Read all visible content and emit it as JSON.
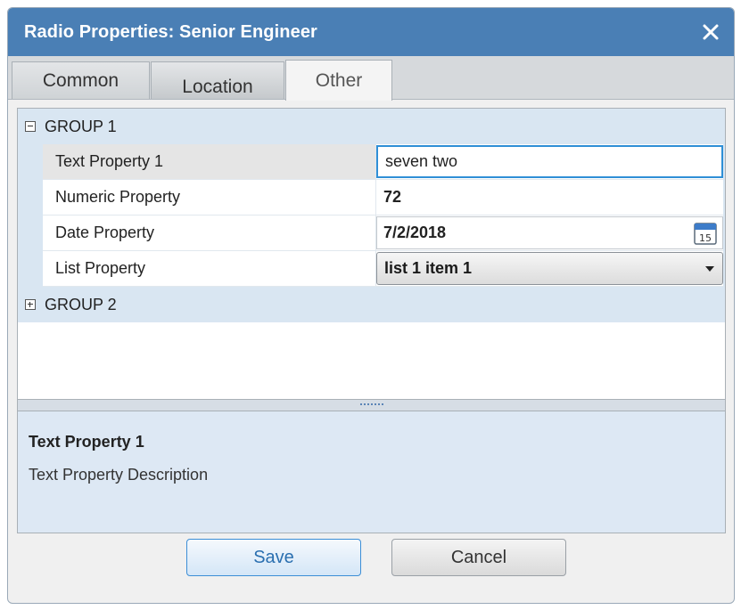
{
  "window": {
    "title": "Radio Properties: Senior Engineer",
    "close_icon": "close-icon"
  },
  "tabs": [
    {
      "label": "Common"
    },
    {
      "label": "Location"
    },
    {
      "label": "Other",
      "active": true
    }
  ],
  "groups": [
    {
      "name": "GROUP 1",
      "expanded": true,
      "properties": [
        {
          "label": "Text Property 1",
          "value": "seven two",
          "type": "text",
          "selected": true
        },
        {
          "label": "Numeric Property",
          "value": "72",
          "type": "numeric"
        },
        {
          "label": "Date Property",
          "value": "7/2/2018",
          "type": "date",
          "calendar_day": "15"
        },
        {
          "label": "List Property",
          "value": "list 1 item 1",
          "type": "list"
        }
      ]
    },
    {
      "name": "GROUP 2",
      "expanded": false
    }
  ],
  "description": {
    "title": "Text Property 1",
    "text": "Text Property Description"
  },
  "buttons": {
    "save": "Save",
    "cancel": "Cancel"
  },
  "colors": {
    "title_bar": "#4a7fb5",
    "group_row": "#d9e6f2",
    "accent": "#2f8fd6"
  }
}
